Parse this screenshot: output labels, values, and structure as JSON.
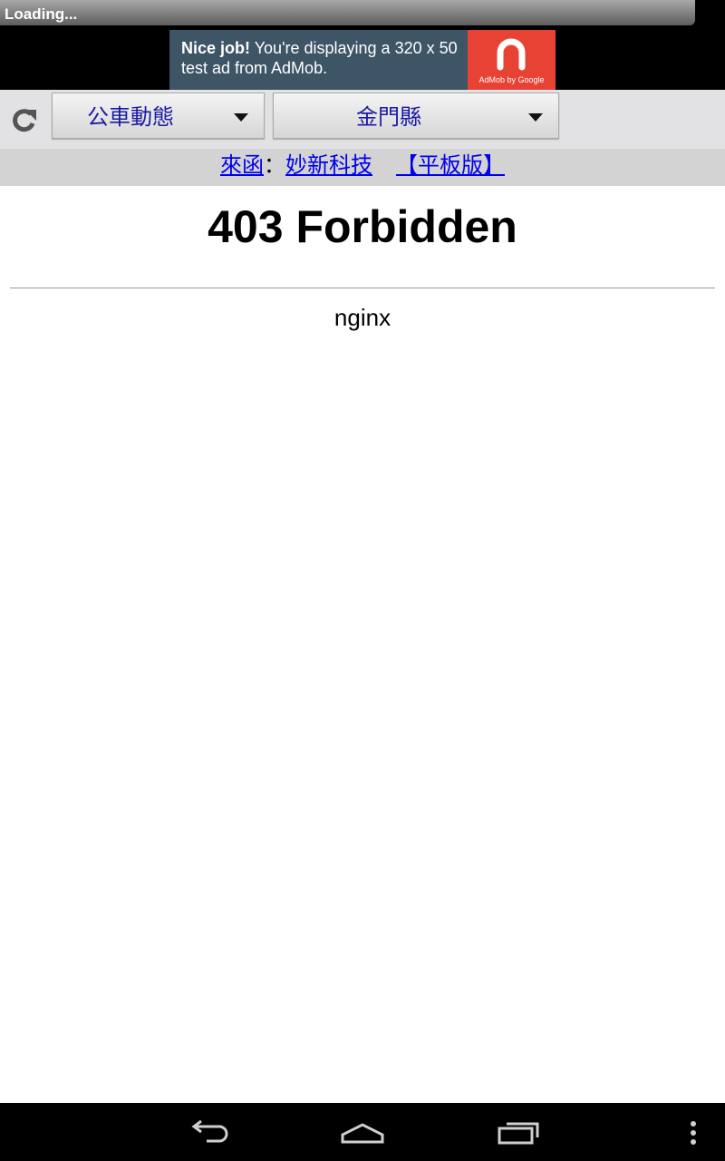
{
  "status_bar": {
    "title": "Loading..."
  },
  "ad": {
    "bold_text": "Nice job!",
    "text": " You're displaying a 320 x 50 test ad from AdMob.",
    "brand": "AdMob by Google",
    "brand_color": "#e84234",
    "background_color": "#3e5566"
  },
  "toolbar": {
    "refresh_icon": "refresh-icon",
    "category_select": {
      "value": "公車動態"
    },
    "county_select": {
      "value": "金門縣"
    }
  },
  "links": {
    "contact_label": "來函",
    "separator": "：",
    "company_label": "妙新科技",
    "tablet_label": "【平板版】",
    "link_color": "#0000ee"
  },
  "content": {
    "heading": "403 Forbidden",
    "server": "nginx"
  },
  "nav_bar": {
    "back_icon": "back-icon",
    "home_icon": "home-icon",
    "recent_icon": "recent-apps-icon",
    "menu_icon": "overflow-menu-icon"
  }
}
